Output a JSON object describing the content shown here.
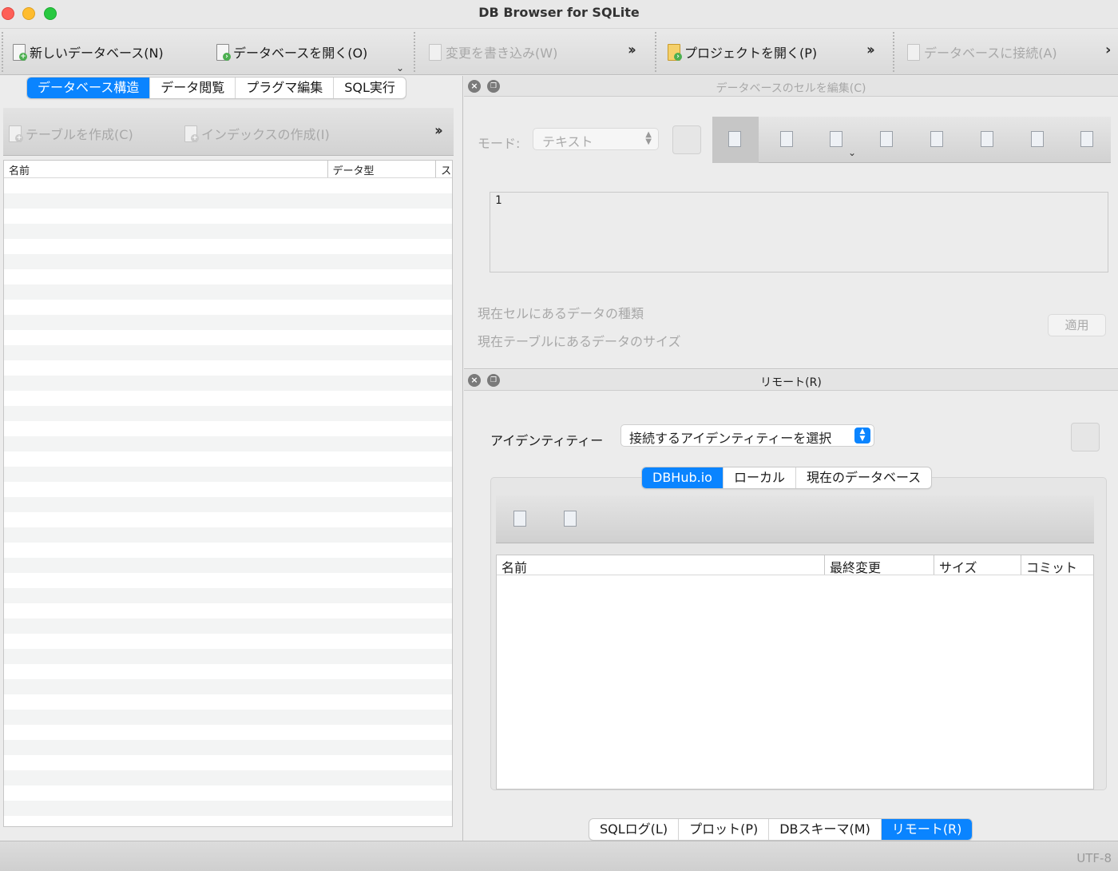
{
  "window": {
    "title": "DB Browser for SQLite"
  },
  "toolbar": {
    "new_db": "新しいデータベース(N)",
    "open_db": "データベースを開く(O)",
    "write_changes": "変更を書き込み(W)",
    "open_project": "プロジェクトを開く(P)",
    "attach_db": "データベースに接続(A)"
  },
  "left_tabs": [
    "データベース構造",
    "データ閲覧",
    "プラグマ編集",
    "SQL実行"
  ],
  "left_toolbar": {
    "create_table": "テーブルを作成(C)",
    "create_index": "インデックスの作成(I)"
  },
  "structure_table": {
    "columns": [
      "名前",
      "データ型",
      "ス"
    ]
  },
  "edit_cell": {
    "title": "データベースのセルを編集(C)",
    "mode_label": "モード:",
    "mode_value": "テキスト",
    "cell_value": "1",
    "type_info": "現在セルにあるデータの種類",
    "size_info": "現在テーブルにあるデータのサイズ",
    "apply": "適用"
  },
  "remote": {
    "title": "リモート(R)",
    "identity_label": "アイデンティティー",
    "identity_value": "接続するアイデンティティーを選択",
    "tabs": [
      "DBHub.io",
      "ローカル",
      "現在のデータベース"
    ],
    "columns": [
      "名前",
      "最終変更",
      "サイズ",
      "コミット"
    ]
  },
  "bottom_tabs": [
    "SQLログ(L)",
    "プロット(P)",
    "DBスキーマ(M)",
    "リモート(R)"
  ],
  "status": {
    "encoding": "UTF-8"
  },
  "colors": {
    "accent": "#0a84ff"
  }
}
